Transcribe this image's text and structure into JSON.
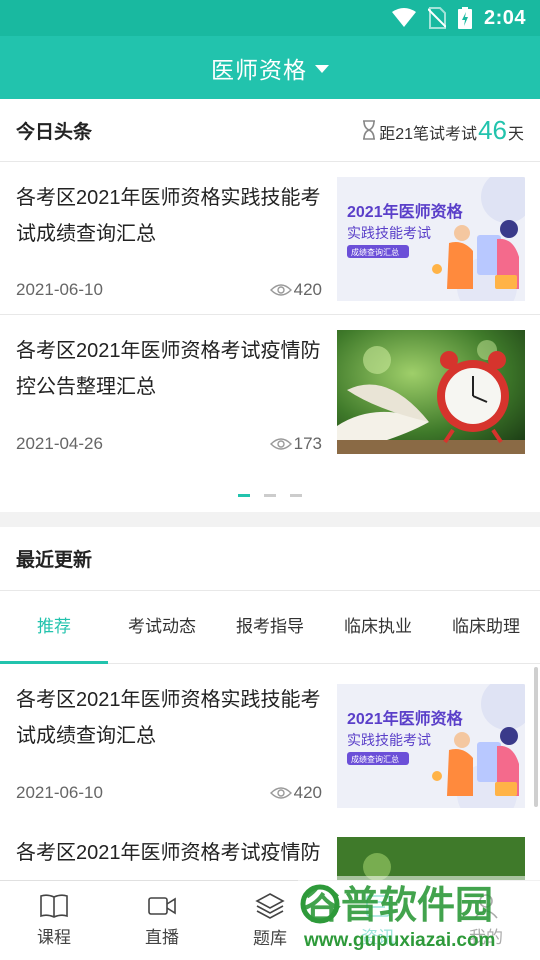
{
  "status_bar": {
    "time": "2:04"
  },
  "header": {
    "title": "医师资格"
  },
  "headlines": {
    "title": "今日头条",
    "countdown": {
      "prefix": "距21笔试考试",
      "days": "46",
      "suffix": "天"
    },
    "items": [
      {
        "title": "各考区2021年医师资格实践技能考试成绩查询汇总",
        "date": "2021-06-10",
        "views": "420",
        "thumb": {
          "line1": "2021年医师资格",
          "line2": "实践技能考试",
          "badge": "成绩查询汇总"
        }
      },
      {
        "title": "各考区2021年医师资格考试疫情防控公告整理汇总",
        "date": "2021-04-26",
        "views": "173"
      }
    ]
  },
  "recent": {
    "title": "最近更新",
    "tabs": [
      "推荐",
      "考试动态",
      "报考指导",
      "临床执业",
      "临床助理"
    ],
    "active_tab": 0,
    "items": [
      {
        "title": "各考区2021年医师资格实践技能考试成绩查询汇总",
        "date": "2021-06-10",
        "views": "420",
        "thumb": {
          "line1": "2021年医师资格",
          "line2": "实践技能考试",
          "badge": "成绩查询汇总"
        }
      },
      {
        "title": "各考区2021年医师资格考试疫情防"
      }
    ]
  },
  "bottom_nav": [
    {
      "label": "课程",
      "icon": "book-icon"
    },
    {
      "label": "直播",
      "icon": "video-camera-icon"
    },
    {
      "label": "题库",
      "icon": "layers-icon"
    },
    {
      "label": "资讯",
      "icon": "news-icon"
    },
    {
      "label": "我的",
      "icon": "user-icon"
    }
  ],
  "watermark": {
    "brand": "谷普软件园",
    "url": "www.gupuxiazai.com"
  },
  "colors": {
    "accent": "#22c3ad",
    "status_bar": "#19b9a0",
    "text": "#222222",
    "muted": "#666666"
  }
}
